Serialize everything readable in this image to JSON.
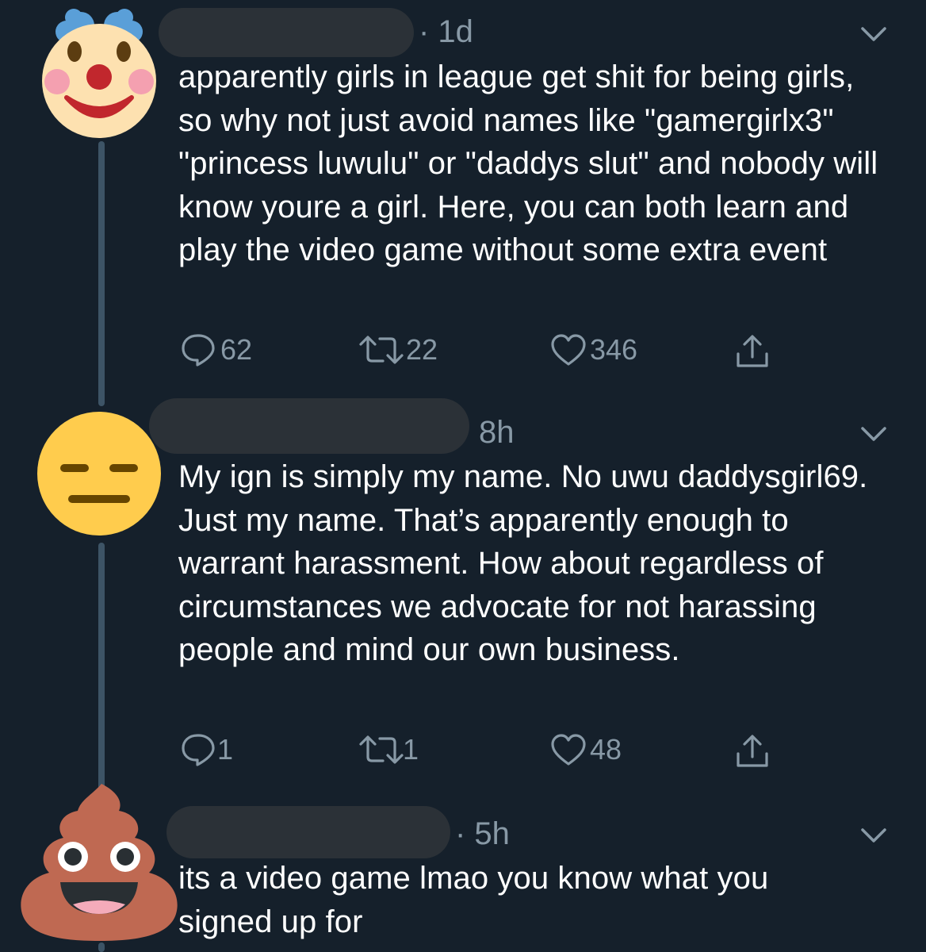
{
  "tweets": [
    {
      "author_avatar": "clown-face-emoji",
      "time": "· 1d",
      "text": "apparently girls in league get shit for being girls, so why not just avoid names like \"gamergirlx3\" \"princess luwulu\" or \"daddys slut\" and nobody will know youre a girl. Here, you can both learn and play the video game without some extra event",
      "replies": "62",
      "retweets": "22",
      "likes": "346"
    },
    {
      "author_avatar": "expressionless-face-emoji",
      "time": "8h",
      "text": "My ign is simply my name. No uwu daddysgirl69. Just my name. That’s apparently enough to warrant harassment. How about regardless of circumstances we advocate for not harassing people and mind our own business.",
      "replies": "1",
      "retweets": "1",
      "likes": "48"
    },
    {
      "author_avatar": "pile-of-poo-emoji",
      "time": "· 5h",
      "text": "its a video game lmao you know what you signed up for"
    }
  ],
  "icons": {
    "reply": "reply-icon",
    "retweet": "retweet-icon",
    "like": "heart-icon",
    "share": "share-icon",
    "menu": "chevron-down-icon"
  },
  "colors": {
    "background": "#15202b",
    "text": "#ffffff",
    "secondary": "#8899a6",
    "thread_line": "#3d5466"
  }
}
